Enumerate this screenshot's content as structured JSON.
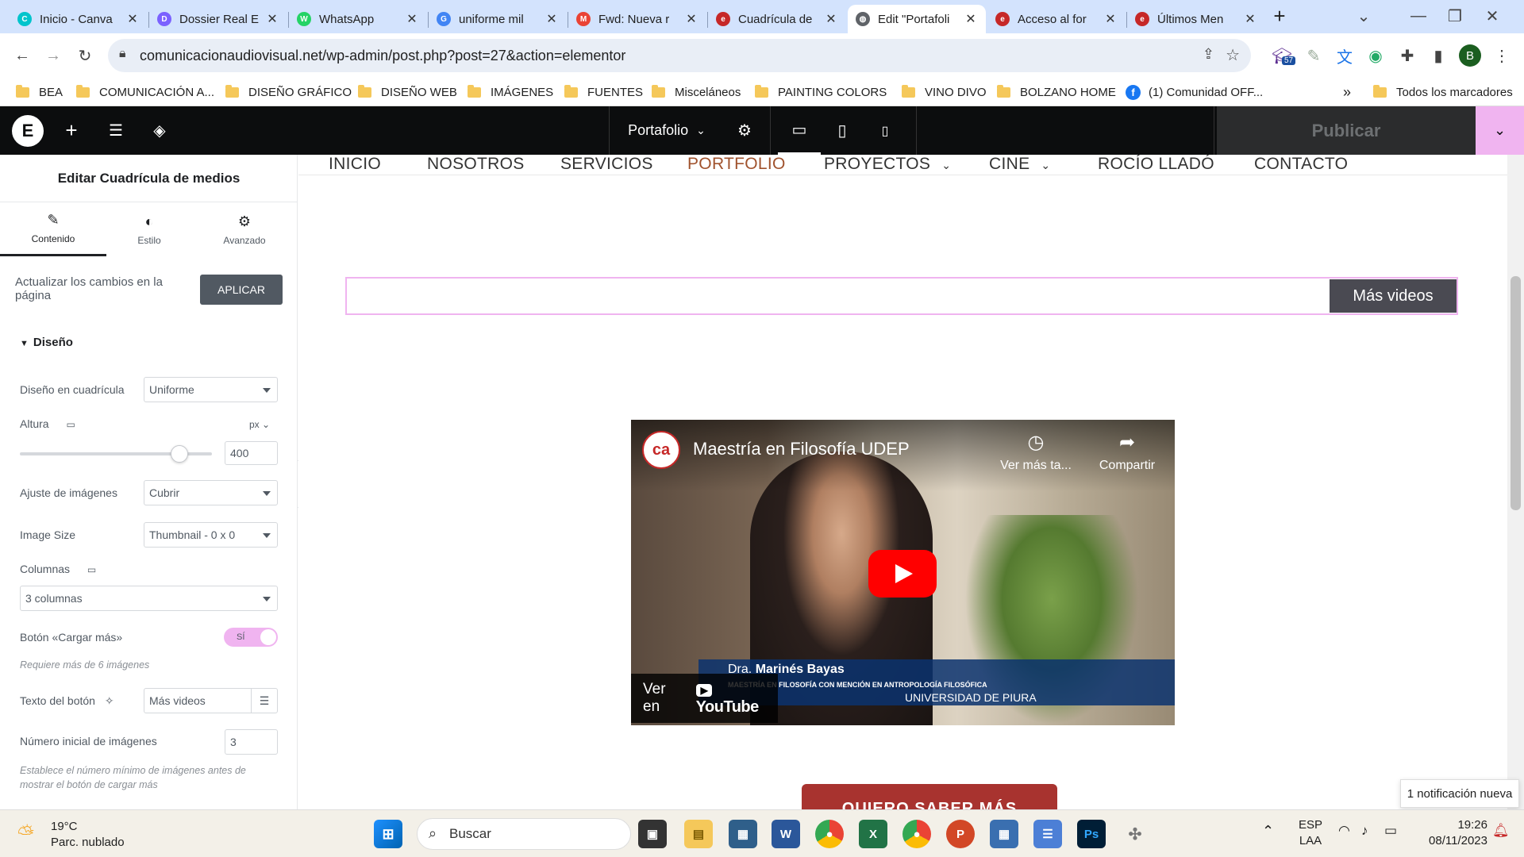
{
  "browser": {
    "tabs": [
      {
        "title": "Inicio - Canva",
        "color": "#00c4cc",
        "glyph": "C"
      },
      {
        "title": "Dossier Real E",
        "color": "#7b61ff",
        "glyph": "D"
      },
      {
        "title": "WhatsApp",
        "color": "#25d366",
        "glyph": "W"
      },
      {
        "title": "uniforme mil",
        "color": "#4285f4",
        "glyph": "G"
      },
      {
        "title": "Fwd: Nueva r",
        "color": "#ea4335",
        "glyph": "M"
      },
      {
        "title": "Cuadrícula de",
        "color": "#c62828",
        "glyph": "e"
      },
      {
        "title": "Edit \"Portafoli",
        "color": "#5f6368",
        "glyph": "◍"
      },
      {
        "title": "Acceso al for",
        "color": "#c62828",
        "glyph": "e"
      },
      {
        "title": "Últimos Men",
        "color": "#c62828",
        "glyph": "e"
      }
    ],
    "new_tab_label": "+",
    "url": "comunicacionaudiovisual.net/wp-admin/post.php?post=27&action=elementor",
    "extension_badge": "57",
    "profile_initial": "B",
    "bookmarks": [
      {
        "label": "BEA"
      },
      {
        "label": "COMUNICACIÓN A..."
      },
      {
        "label": "DISEÑO GRÁFICO"
      },
      {
        "label": "DISEÑO WEB"
      },
      {
        "label": "IMÁGENES"
      },
      {
        "label": "FUENTES"
      },
      {
        "label": "Misceláneos"
      },
      {
        "label": "PAINTING COLORS"
      },
      {
        "label": "VINO DIVO"
      },
      {
        "label": "BOLZANO HOME"
      },
      {
        "label": "(1) Comunidad OFF..."
      }
    ],
    "bookmarks_overflow": "»",
    "all_bookmarks": "Todos los marcadores"
  },
  "elementor": {
    "logo_letter": "E",
    "page_name": "Portafolio",
    "publish_label": "Publicar",
    "accent": "#f0b4f0"
  },
  "panel": {
    "title": "Editar Cuadrícula de medios",
    "tabs": [
      "Contenido",
      "Estilo",
      "Avanzado"
    ],
    "apply_text": "Actualizar los cambios en la página",
    "apply_button": "APLICAR",
    "section": "Diseño",
    "grid_layout_label": "Diseño en cuadrícula",
    "grid_layout_value": "Uniforme",
    "height_label": "Altura",
    "height_unit": "px",
    "height_value": "400",
    "height_slider_fraction": 0.83,
    "fit_label": "Ajuste de imágenes",
    "fit_value": "Cubrir",
    "size_label": "Image Size",
    "size_value": "Thumbnail - 0 x 0",
    "columns_label": "Columnas",
    "columns_value": "3 columnas",
    "load_more_label": "Botón «Cargar más»",
    "load_more_toggle": "SÍ",
    "load_more_note": "Requiere más de 6 imágenes",
    "button_text_label": "Texto del botón",
    "button_text_value": "Más videos",
    "initial_label": "Número inicial de imágenes",
    "initial_value": "3",
    "initial_note": "Establece el número mínimo de imágenes antes de mostrar el botón de cargar más"
  },
  "site": {
    "nav": [
      "INICIO",
      "NOSOTROS",
      "SERVICIOS",
      "PORTFOLIO",
      "PROYECTOS",
      "CINE",
      "ROCÍO LLADÓ",
      "CONTACTO"
    ],
    "active_nav": "PORTFOLIO",
    "more_button": "Más videos",
    "video": {
      "title": "Maestría en Filosofía UDEP",
      "watch_later": "Ver más ta...",
      "share": "Compartir",
      "name_prefix": "Dra.",
      "name": "Marinés Bayas",
      "subtitle": "MAESTRÍA EN FILOSOFÍA CON MENCIÓN EN ANTROPOLOGÍA FILOSÓFICA",
      "university": "UNIVERSIDAD DE PIURA",
      "watch_on": "Ver en",
      "youtube": "YouTube"
    },
    "cta": "QUIERO SABER MÁS"
  },
  "notification": "1 notificación nueva",
  "taskbar": {
    "weather_temp": "19°C",
    "weather_desc": "Parc. nublado",
    "search": "Buscar",
    "lang_top": "ESP",
    "lang_bottom": "LAA",
    "time": "19:26",
    "date": "08/11/2023"
  }
}
